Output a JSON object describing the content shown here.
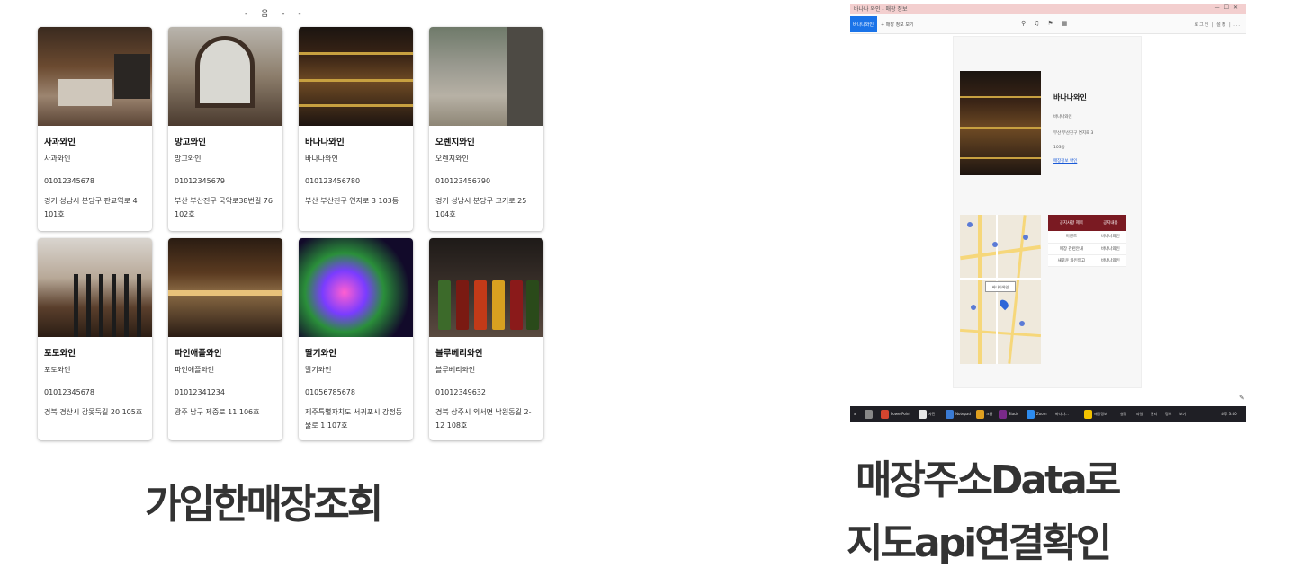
{
  "left_panel": {
    "top_fragment": "- 음 - -",
    "stores": [
      {
        "name": "사과와인",
        "sub": "사과와인",
        "phone": "01012345678",
        "address": "경기 성남시 분당구 판교역로 4 101호"
      },
      {
        "name": "망고와인",
        "sub": "망고와인",
        "phone": "01012345679",
        "address": "부산 부산진구 국악로38번길 76 102호"
      },
      {
        "name": "바나나와인",
        "sub": "바나나와인",
        "phone": "010123456780",
        "address": "부산 부산진구 연지로 3 103동"
      },
      {
        "name": "오렌지와인",
        "sub": "오렌지와인",
        "phone": "010123456790",
        "address": "경기 성남시 분당구 고기로 25 104호"
      },
      {
        "name": "포도와인",
        "sub": "포도와인",
        "phone": "01012345678",
        "address": "경북 경산시 감못둑길 20 105호"
      },
      {
        "name": "파인애플와인",
        "sub": "파인애플와인",
        "phone": "01012341234",
        "address": "광주 남구 제중로 11 106호"
      },
      {
        "name": "딸기와인",
        "sub": "딸기와인",
        "phone": "01056785678",
        "address": "제주특별자치도 서귀포시 강정동물로 1 107호"
      },
      {
        "name": "블루베리와인",
        "sub": "블루베리와인",
        "phone": "01012349632",
        "address": "경북 상주시 외서면 낙원동길 2-12 108호"
      }
    ],
    "caption": "가입한매장조회"
  },
  "right_panel": {
    "window_title": "바나나 와인 - 매장 정보",
    "toolbar": {
      "active_tab": "바나나와인",
      "tab": "+ 매장 정보 보기",
      "icons": [
        "zoom-icon",
        "bell-icon",
        "pin-icon",
        "read-icon"
      ],
      "right_text": "로그인 | 설정 | ..."
    },
    "detail": {
      "name": "바나나와인",
      "lines": [
        "바나나와인",
        "부산 부산진구 연지로 3",
        "103동"
      ],
      "link": "매장정보 확인"
    },
    "map": {
      "pin_label": "바나나와인"
    },
    "table": {
      "headers": [
        "공지사항 제목",
        "공지내용"
      ],
      "rows": [
        [
          "이벤트",
          "바나나와인"
        ],
        [
          "매장 관련안내",
          "바나나와인"
        ],
        [
          "새로운 와인입고",
          "바나나와인"
        ]
      ]
    },
    "taskbar": {
      "items": [
        "PowerPoint",
        "사진",
        "Notepad",
        "크롬",
        "Slack",
        "Zoom",
        "바나나...",
        "매장정보",
        "설정",
        "파일",
        "관리",
        "정보",
        "보기"
      ],
      "clock": "오후 3:40"
    },
    "caption_line1": "매장주소Data로",
    "caption_line2": "지도api연결확인"
  }
}
